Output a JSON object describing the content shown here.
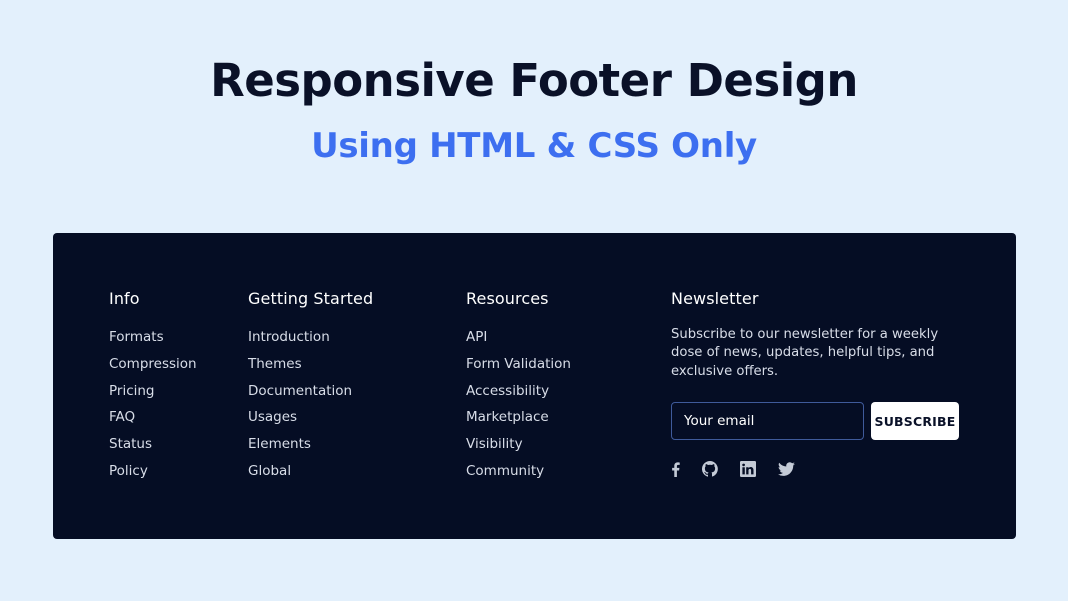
{
  "hero": {
    "title": "Responsive Footer Design",
    "subtitle": "Using HTML & CSS Only",
    "title_color": "#0a1128",
    "subtitle_color": "#3d6ff0"
  },
  "footer": {
    "background": "#050d24",
    "columns": [
      {
        "heading": "Info",
        "links": [
          "Formats",
          "Compression",
          "Pricing",
          "FAQ",
          "Status",
          "Policy"
        ]
      },
      {
        "heading": "Getting Started",
        "links": [
          "Introduction",
          "Themes",
          "Documentation",
          "Usages",
          "Elements",
          "Global"
        ]
      },
      {
        "heading": "Resources",
        "links": [
          "API",
          "Form Validation",
          "Accessibility",
          "Marketplace",
          "Visibility",
          "Community"
        ]
      }
    ],
    "newsletter": {
      "heading": "Newsletter",
      "description": "Subscribe to our newsletter for a weekly dose of news, updates, helpful tips, and exclusive offers.",
      "email_placeholder": "Your email",
      "email_value": "",
      "subscribe_label": "SUBSCRIBE",
      "socials": [
        {
          "name": "facebook",
          "icon": "facebook-icon"
        },
        {
          "name": "github",
          "icon": "github-icon"
        },
        {
          "name": "linkedin",
          "icon": "linkedin-icon"
        },
        {
          "name": "twitter",
          "icon": "twitter-icon"
        }
      ]
    }
  }
}
